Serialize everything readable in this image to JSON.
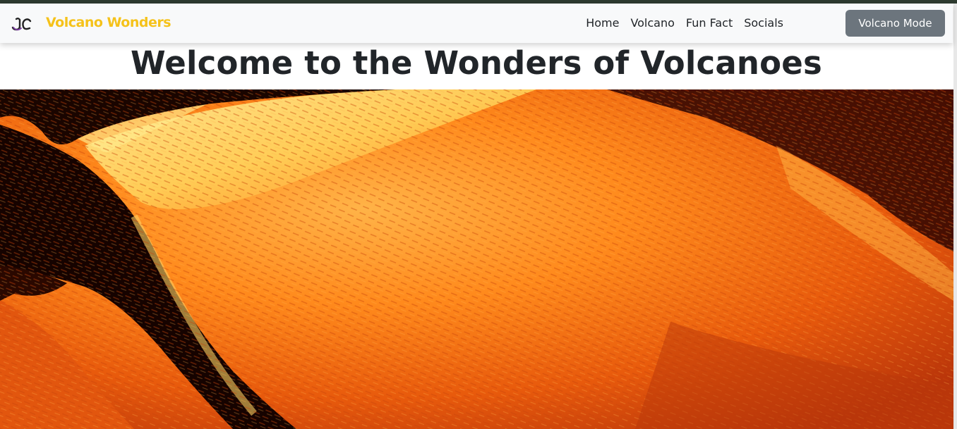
{
  "navbar": {
    "brand": {
      "logo_icon": "jc-logo-icon",
      "name": "Volcano Wonders",
      "color": "#f5c21a"
    },
    "links": [
      {
        "label": "Home"
      },
      {
        "label": "Volcano"
      },
      {
        "label": "Fun Fact"
      },
      {
        "label": "Socials"
      }
    ],
    "mode_button": {
      "label": "Volcano Mode",
      "color": "#6c757d"
    }
  },
  "main": {
    "title": "Welcome to the Wonders of Volcanoes",
    "hero_image": "lava-flow-image"
  }
}
